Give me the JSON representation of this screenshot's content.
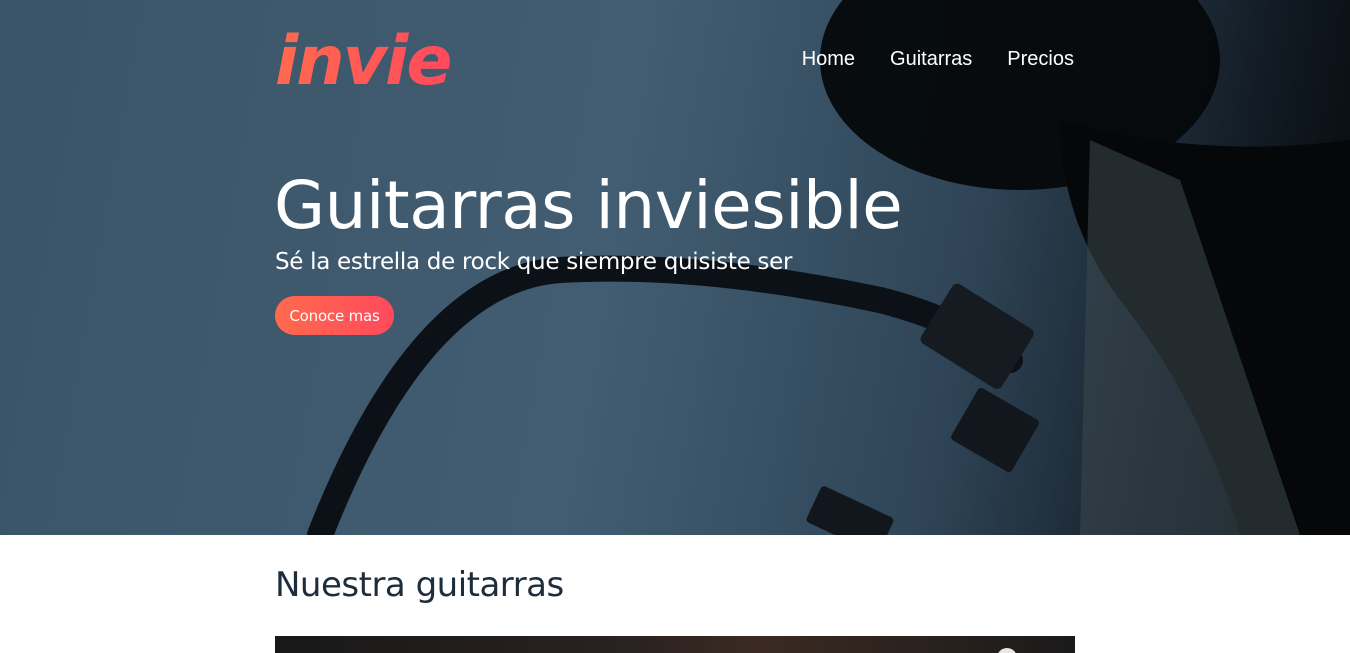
{
  "brand": {
    "logo_text": "invie"
  },
  "nav": {
    "items": [
      "Home",
      "Guitarras",
      "Precios"
    ]
  },
  "hero": {
    "title": "Guitarras inviesible",
    "subtitle": "Sé la estrella de rock que siempre quisiste ser",
    "cta_label": "Conoce mas"
  },
  "section": {
    "title": "Nuestra guitarras"
  },
  "colors": {
    "accent_start": "#ff6a4d",
    "accent_end": "#ff4a5c",
    "hero_bg": "#425d72",
    "heading": "#1e2d3b"
  },
  "icons": {
    "video_control": "clock-icon"
  }
}
